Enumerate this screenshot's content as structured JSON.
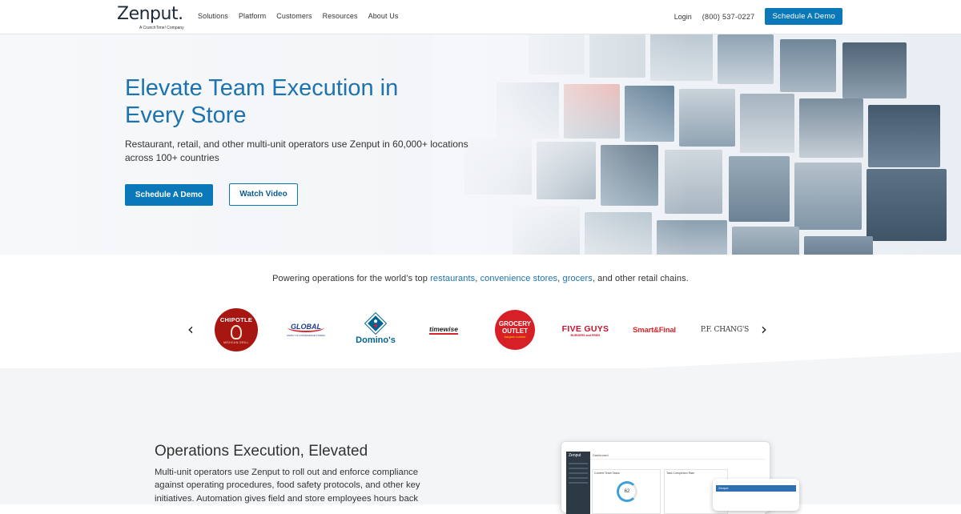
{
  "nav": {
    "logo": "Zenput.",
    "logo_sub": "A CrunchTime! Company",
    "links": [
      "Solutions",
      "Platform",
      "Customers",
      "Resources",
      "About Us"
    ],
    "login": "Login",
    "phone": "(800) 537-0227",
    "cta": "Schedule A Demo"
  },
  "hero": {
    "title": "Elevate Team Execution in Every Store",
    "subtitle": "Restaurant, retail, and other multi-unit operators use Zenput in 60,000+ locations across 100+ countries",
    "primary_button": "Schedule A Demo",
    "secondary_button": "Watch Video"
  },
  "customers": {
    "intro_prefix": "Powering operations for the world’s top ",
    "link1": "restaurants",
    "sep1": ", ",
    "link2": "convenience stores",
    "sep2": ", ",
    "link3": "grocers",
    "intro_suffix": ", and other retail chains.",
    "prev_arrow": "‹",
    "next_arrow": "›",
    "brands": [
      {
        "name": "Chipotle",
        "text": "CHIPOTLE",
        "sub": "MEXICAN GRILL"
      },
      {
        "name": "Global",
        "text": "GLOBAL",
        "sub": "FAMILY OF CONVENIENCE STORES"
      },
      {
        "name": "Dominos",
        "text": "Domino's"
      },
      {
        "name": "Timewise",
        "text": "timewise"
      },
      {
        "name": "Grocery Outlet",
        "text": "GROCERY",
        "text2": "OUTLET",
        "sub": "bargain market"
      },
      {
        "name": "Five Guys",
        "text": "FIVE GUYS",
        "sub": "BURGERS and FRIES"
      },
      {
        "name": "Smart & Final",
        "text": "Smart&Final"
      },
      {
        "name": "PF Changs",
        "text": "P.F. CHANG'S"
      }
    ]
  },
  "section2": {
    "title": "Operations Execution, Elevated",
    "body": "Multi-unit operators use Zenput to roll out and enforce compliance against operating procedures, food safety protocols, and other key initiatives. Automation gives field and store employees hours back",
    "dash": {
      "brand": "Zenput",
      "header": "Dashboard",
      "card1": "Current Team Tasks",
      "card2": "Task Completion Rate",
      "gauge": "62",
      "phone_title": "Zenput"
    }
  },
  "colors": {
    "brand_blue": "#0a78b9",
    "title_blue": "#1d73ad",
    "chipotle": "#a81612",
    "five_guys": "#c8102e",
    "dominos_blue": "#006491"
  }
}
